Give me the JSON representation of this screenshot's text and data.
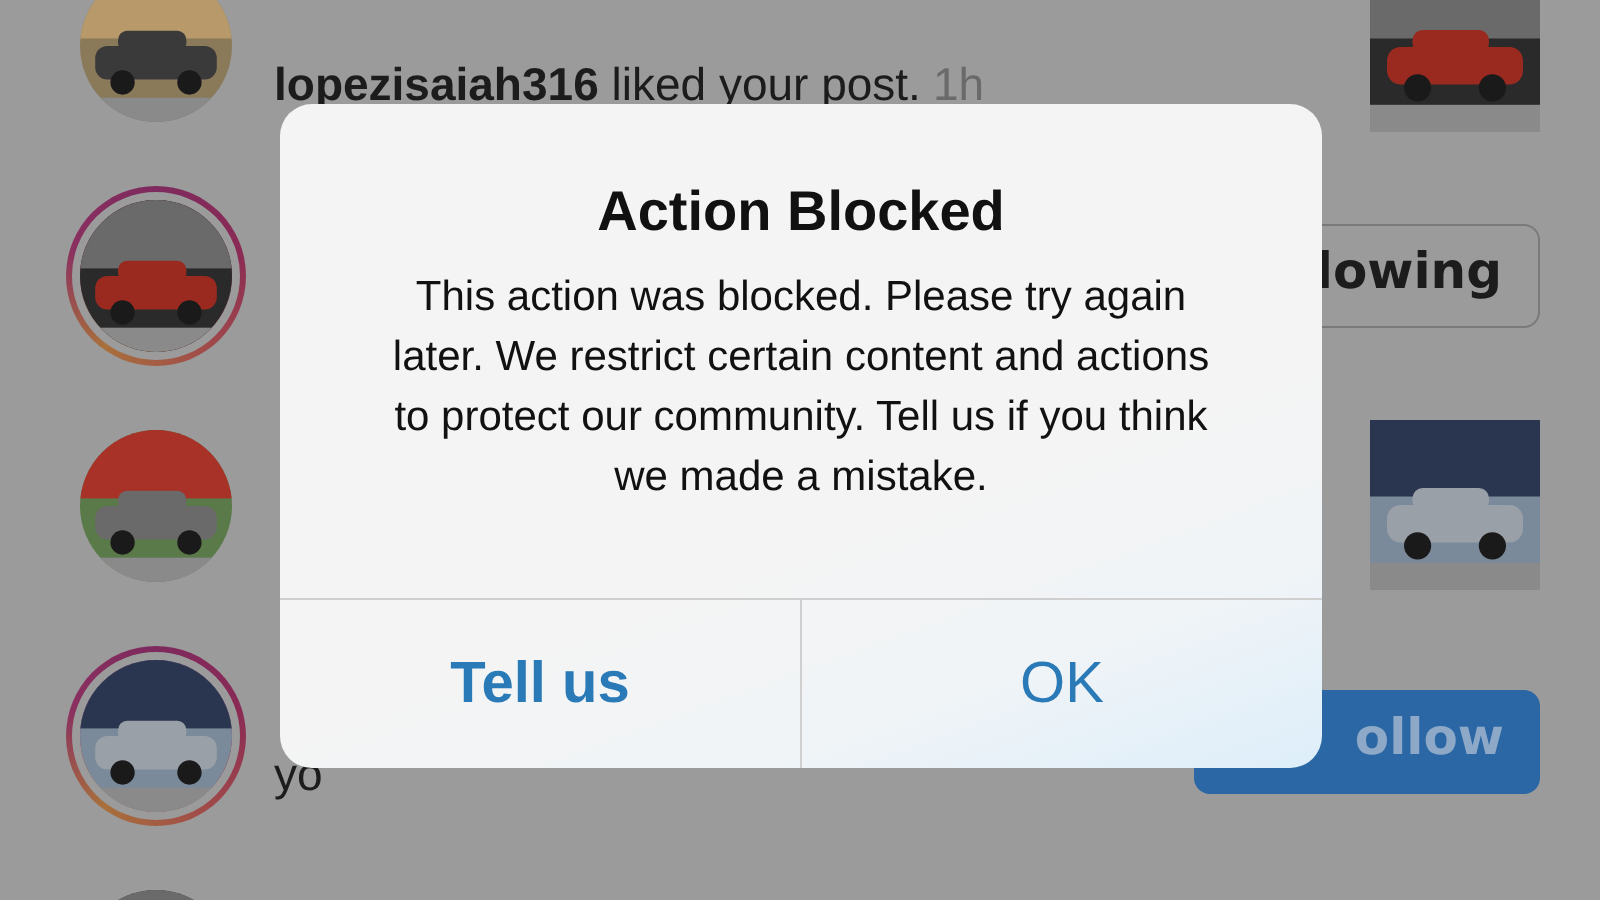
{
  "feed": [
    {
      "avatar": {
        "kind": "picture",
        "ring": false
      },
      "text": "**lopezisaiah316** liked your post.",
      "time": "1h",
      "action": {
        "kind": "thumbnail"
      }
    },
    {
      "avatar": {
        "kind": "picture",
        "ring": true
      },
      "action": {
        "kind": "outline_button",
        "label": "lowing"
      }
    },
    {
      "avatar": {
        "kind": "picture",
        "ring": false
      },
      "action": {
        "kind": "thumbnail"
      }
    },
    {
      "avatar": {
        "kind": "picture",
        "ring": true
      },
      "text": "yo",
      "action": {
        "kind": "filled_button",
        "label": "ollow"
      }
    },
    {
      "avatar": {
        "kind": "picture",
        "ring": false
      }
    }
  ],
  "alert": {
    "title": "Action Blocked",
    "message": "This action was blocked. Please try again later. We restrict certain content and actions to protect our community. Tell us if you think we made a mistake.",
    "buttons": [
      {
        "label": "Tell us",
        "kind": "preferred"
      },
      {
        "label": "OK",
        "kind": "plain"
      }
    ]
  }
}
